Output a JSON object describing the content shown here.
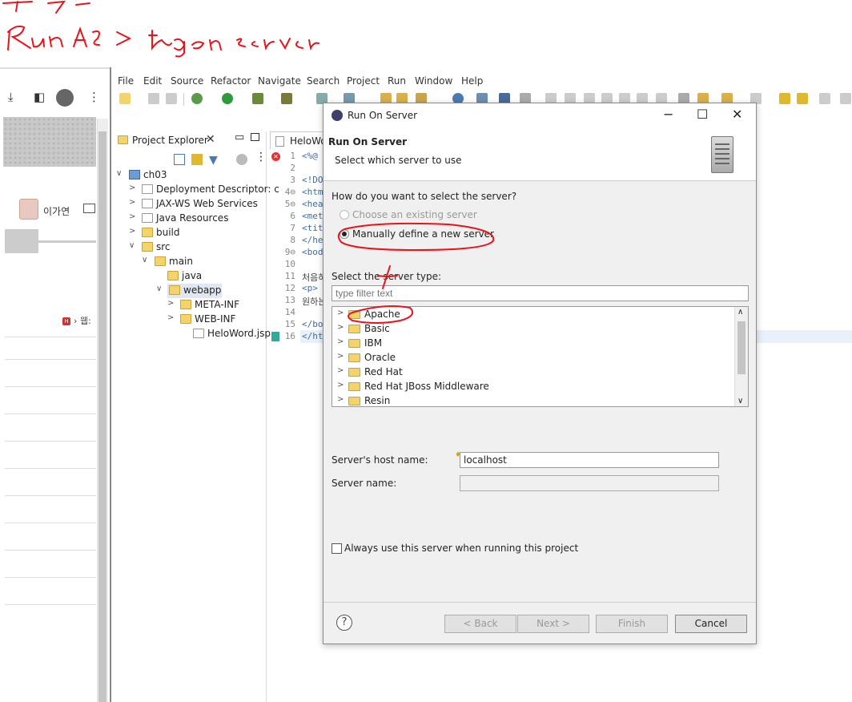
{
  "annotation": {
    "line2": "Run As -> Run on server"
  },
  "browser": {
    "username": "이가연",
    "crumb": "웹:"
  },
  "menu": [
    "File",
    "Edit",
    "Source",
    "Refactor",
    "Navigate",
    "Search",
    "Project",
    "Run",
    "Window",
    "Help"
  ],
  "project_explorer": {
    "title": "Project Explorer",
    "tree": [
      {
        "label": "ch03",
        "level": 0,
        "chev": "∨",
        "kind": "proj"
      },
      {
        "label": "Deployment Descriptor: c",
        "level": 1,
        "chev": ">",
        "kind": "file"
      },
      {
        "label": "JAX-WS Web Services",
        "level": 1,
        "chev": ">",
        "kind": "file"
      },
      {
        "label": "Java Resources",
        "level": 1,
        "chev": ">",
        "kind": "file"
      },
      {
        "label": "build",
        "level": 1,
        "chev": ">",
        "kind": "folder"
      },
      {
        "label": "src",
        "level": 1,
        "chev": "∨",
        "kind": "folder"
      },
      {
        "label": "main",
        "level": 2,
        "chev": "∨",
        "kind": "folder"
      },
      {
        "label": "java",
        "level": 3,
        "chev": "",
        "kind": "folder"
      },
      {
        "label": "webapp",
        "level": 3,
        "chev": "∨",
        "kind": "folder",
        "selected": true
      },
      {
        "label": "META-INF",
        "level": 4,
        "chev": ">",
        "kind": "folder"
      },
      {
        "label": "WEB-INF",
        "level": 4,
        "chev": ">",
        "kind": "folder"
      },
      {
        "label": "HeloWord.jsp",
        "level": 5,
        "chev": "",
        "kind": "file"
      }
    ]
  },
  "editor": {
    "tab": "HeloWo",
    "lines": [
      {
        "n": "1",
        "code": "<%@"
      },
      {
        "n": "2",
        "code": ""
      },
      {
        "n": "3",
        "code": "<!DO"
      },
      {
        "n": "4⊖",
        "code": "<htm"
      },
      {
        "n": "5⊖",
        "code": "<hea"
      },
      {
        "n": "6",
        "code": "<met"
      },
      {
        "n": "7",
        "code": "<tit"
      },
      {
        "n": "8",
        "code": "</he"
      },
      {
        "n": "9⊖",
        "code": "<bod"
      },
      {
        "n": "10",
        "code": ""
      },
      {
        "n": "11",
        "code": "처음하"
      },
      {
        "n": "12",
        "code": "<p>"
      },
      {
        "n": "13",
        "code": "원하는"
      },
      {
        "n": "14",
        "code": ""
      },
      {
        "n": "15",
        "code": "</bo"
      },
      {
        "n": "16",
        "code": "</ht"
      }
    ]
  },
  "dialog": {
    "window_title": "Run On Server",
    "heading": "Run On Server",
    "subheading": "Select which server to use",
    "question": "How do you want to select the server?",
    "option_existing": "Choose an existing server",
    "option_manual": "Manually define a new server",
    "server_type_label": "Select the server type:",
    "filter_placeholder": "type filter text",
    "server_types": [
      "Apache",
      "Basic",
      "IBM",
      "Oracle",
      "Red Hat",
      "Red Hat JBoss Middleware",
      "Resin"
    ],
    "host_label": "Server's host name:",
    "host_value": "localhost",
    "name_label": "Server name:",
    "name_value": "",
    "always_use": "Always use this server when running this project",
    "buttons": {
      "back": "< Back",
      "next": "Next >",
      "finish": "Finish",
      "cancel": "Cancel"
    },
    "help": "?"
  }
}
